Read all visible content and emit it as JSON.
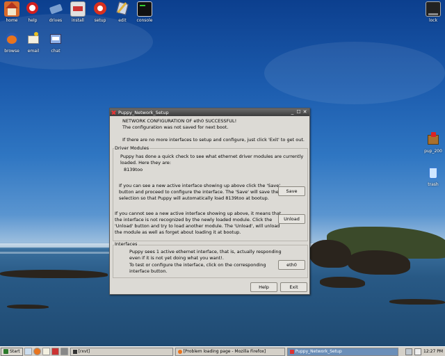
{
  "desktop": {
    "icons_row1": [
      {
        "label": "home",
        "icon": "home-icon"
      },
      {
        "label": "help",
        "icon": "help-icon"
      },
      {
        "label": "drives",
        "icon": "drives-icon"
      },
      {
        "label": "install",
        "icon": "install-icon"
      },
      {
        "label": "setup",
        "icon": "setup-icon"
      },
      {
        "label": "edit",
        "icon": "edit-icon"
      },
      {
        "label": "console",
        "icon": "console-icon"
      }
    ],
    "icons_row2": [
      {
        "label": "browse",
        "icon": "browser-icon"
      },
      {
        "label": "email",
        "icon": "email-icon"
      },
      {
        "label": "chat",
        "icon": "chat-icon"
      }
    ],
    "icon_lock": {
      "label": "lock",
      "icon": "lock-icon"
    },
    "icon_pup": {
      "label": "pup_200",
      "icon": "package-icon"
    },
    "icon_trash": {
      "label": "trash",
      "icon": "trash-icon"
    }
  },
  "window": {
    "title": "Puppy_Network_Setup",
    "controls": {
      "minimize": "_",
      "maximize": "☐",
      "close": "✕"
    },
    "header_line1": "NETWORK CONFIGURATION OF eth0 SUCCESSFUL!",
    "header_line2": "The configuration was not saved for next boot.",
    "header_line3": "If there are no more interfaces to setup and configure, just click 'Exit' to get out.",
    "driver_modules": {
      "label": "Driver Modules",
      "intro_line1": "Puppy has done a quick check to see what ethernet driver modules are currently",
      "intro_line2": "loaded. Here they are:",
      "module": "8139too",
      "save_line1": "If you can see a new active interface showing up above click the 'Save'",
      "save_line2": "button and proceed to configure the interface. The 'Save' will save the",
      "save_line3": "selection so that Puppy will automatically load 8139too at bootup.",
      "save_button": "Save",
      "unload_line1": "If you cannot see a new active interface showing up above, it means that",
      "unload_line2": "the interface is not recognized by the newly loaded module. Click the",
      "unload_line3": "'Unload' button and try to load another module. The 'Unload', will unload",
      "unload_line4": "the module as well as forget about loading it at bootup.",
      "unload_button": "Unload"
    },
    "interfaces": {
      "label": "Interfaces",
      "line1": "Puppy sees 1 active ethernet interface, that is, actually responding",
      "line2": "even if it is not yet doing what you want!.",
      "line3": "To test or configure the interface, click on the corresponding",
      "line4": "interface button.",
      "eth_button": "eth0"
    },
    "help_button": "Help",
    "exit_button": "Exit"
  },
  "taskbar": {
    "start_label": "Start",
    "tasks": [
      {
        "label": "[rxvt]"
      },
      {
        "label": "[Problem loading page - Mozilla Firefox]"
      },
      {
        "label": "Puppy_Network_Setup"
      }
    ],
    "clock": "12:27 PM"
  }
}
